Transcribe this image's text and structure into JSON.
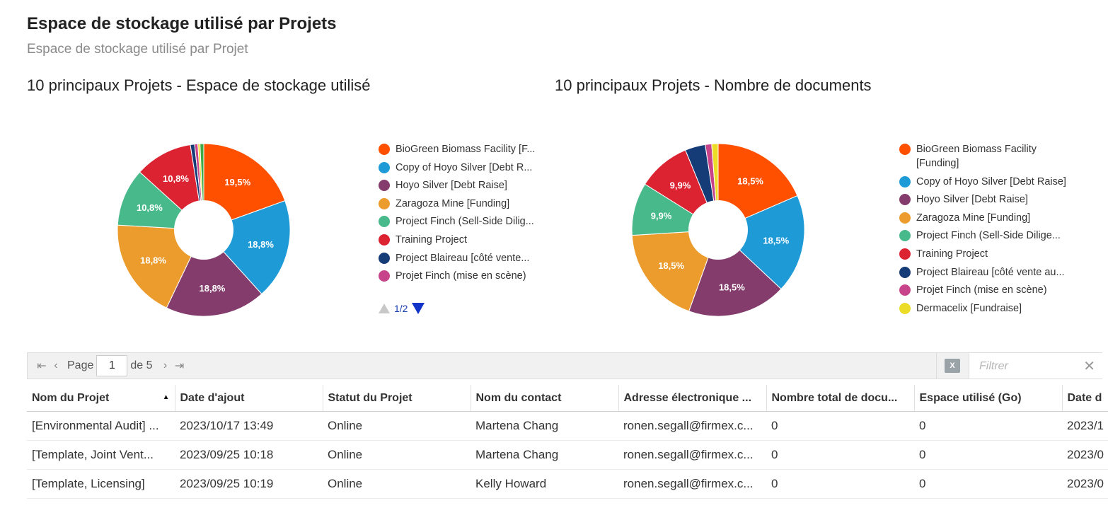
{
  "header": {
    "title": "Espace de stockage utilisé par Projets",
    "subtitle": "Espace de stockage utilisé par Projet"
  },
  "colors": {
    "orange": "#ff5000",
    "blue": "#1e9bd7",
    "plum": "#843c6c",
    "amber": "#eb9c2d",
    "green": "#48b98a",
    "red": "#dc2332",
    "navy": "#163c78",
    "pink": "#c8448a",
    "yellow": "#ecdc28"
  },
  "chart_data": [
    {
      "type": "pie",
      "title": "10 principaux Projets - Espace de stockage utilisé",
      "legend_position": "right",
      "legend_entries": [
        "BioGreen Biomass Facility [F...",
        "Copy of Hoyo Silver [Debt R...",
        "Hoyo Silver [Debt Raise]",
        "Zaragoza Mine [Funding]",
        "Project Finch (Sell-Side Dilig...",
        "Training Project",
        "Project Blaireau [côté vente...",
        "Projet Finch (mise en scène)"
      ],
      "slices": [
        {
          "color": "#ff5000",
          "value": 19.5,
          "label": "19,5%"
        },
        {
          "color": "#1e9bd7",
          "value": 18.8,
          "label": "18,8%"
        },
        {
          "color": "#843c6c",
          "value": 18.8,
          "label": "18,8%"
        },
        {
          "color": "#eb9c2d",
          "value": 18.8,
          "label": "18,8%"
        },
        {
          "color": "#48b98a",
          "value": 10.8,
          "label": "10,8%"
        },
        {
          "color": "#dc2332",
          "value": 10.8,
          "label": "10,8%"
        },
        {
          "color": "#163c78",
          "value": 0.8,
          "label": ""
        },
        {
          "color": "#c8448a",
          "value": 0.6,
          "label": ""
        },
        {
          "color": "#ecdc28",
          "value": 0.4,
          "label": ""
        },
        {
          "color": "#3dab48",
          "value": 0.7,
          "label": ""
        }
      ],
      "legend_page": "1/2"
    },
    {
      "type": "pie",
      "title": "10 principaux Projets - Nombre de documents",
      "legend_position": "right",
      "legend_entries": [
        "BioGreen Biomass Facility [Funding]",
        "Copy of Hoyo Silver [Debt Raise]",
        "Hoyo Silver [Debt Raise]",
        "Zaragoza Mine [Funding]",
        "Project Finch (Sell-Side Dilige...",
        "Training Project",
        "Project Blaireau [côté vente au...",
        "Projet Finch (mise en scène)",
        "Dermacelix [Fundraise]"
      ],
      "slices": [
        {
          "color": "#ff5000",
          "value": 18.5,
          "label": "18,5%"
        },
        {
          "color": "#1e9bd7",
          "value": 18.5,
          "label": "18,5%"
        },
        {
          "color": "#843c6c",
          "value": 18.5,
          "label": "18,5%"
        },
        {
          "color": "#eb9c2d",
          "value": 18.5,
          "label": "18,5%"
        },
        {
          "color": "#48b98a",
          "value": 9.9,
          "label": "9,9%"
        },
        {
          "color": "#dc2332",
          "value": 9.9,
          "label": "9,9%"
        },
        {
          "color": "#163c78",
          "value": 3.8,
          "label": ""
        },
        {
          "color": "#c8448a",
          "value": 1.2,
          "label": ""
        },
        {
          "color": "#ecdc28",
          "value": 1.2,
          "label": ""
        }
      ]
    }
  ],
  "pager": {
    "page_label": "Page",
    "current_page": "1",
    "of_label": "de 5",
    "filter_placeholder": "Filtrer"
  },
  "grid": {
    "columns": [
      "Nom du Projet",
      "Date d'ajout",
      "Statut du Projet",
      "Nom du contact",
      "Adresse électronique ...",
      "Nombre total de docu...",
      "Espace utilisé (Go)",
      "Date d"
    ],
    "rows": [
      [
        "[Environmental Audit] ...",
        "2023/10/17 13:49",
        "Online",
        "Martena Chang",
        "ronen.segall@firmex.c...",
        "0",
        "0",
        "2023/1"
      ],
      [
        "[Template, Joint Vent...",
        "2023/09/25 10:18",
        "Online",
        "Martena Chang",
        "ronen.segall@firmex.c...",
        "0",
        "0",
        "2023/0"
      ],
      [
        "[Template, Licensing]",
        "2023/09/25 10:19",
        "Online",
        "Kelly Howard",
        "ronen.segall@firmex.c...",
        "0",
        "0",
        "2023/0"
      ]
    ]
  }
}
